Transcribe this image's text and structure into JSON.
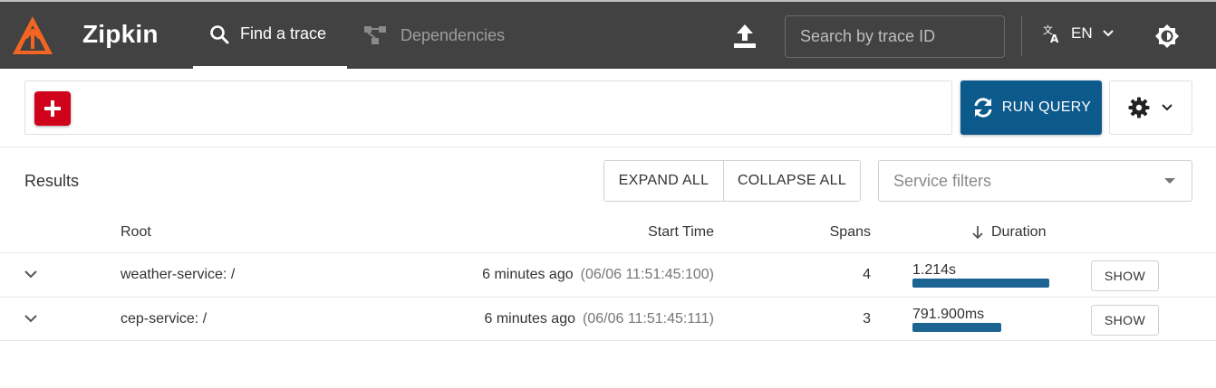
{
  "header": {
    "brand": "Zipkin",
    "tabs": [
      {
        "label": "Find a trace",
        "icon": "search-icon",
        "active": true
      },
      {
        "label": "Dependencies",
        "icon": "dependencies-icon",
        "active": false
      }
    ],
    "search_placeholder": "Search by trace ID",
    "language": "EN",
    "colors": {
      "bar": "#424242",
      "logo": "#f26522"
    }
  },
  "query": {
    "run_label": "RUN QUERY",
    "colors": {
      "add": "#d0021b",
      "run": "#0c5a8c"
    }
  },
  "results": {
    "title": "Results",
    "expand_label": "EXPAND ALL",
    "collapse_label": "COLLAPSE ALL",
    "service_filter_placeholder": "Service filters",
    "columns": {
      "root": "Root",
      "start_time": "Start Time",
      "spans": "Spans",
      "duration": "Duration"
    },
    "rows": [
      {
        "root": "weather-service: /",
        "relative_time": "6 minutes ago",
        "absolute_time": "(06/06 11:51:45:100)",
        "spans": "4",
        "duration": "1.214s",
        "duration_fraction": 1.0,
        "show_label": "SHOW"
      },
      {
        "root": "cep-service: /",
        "relative_time": "6 minutes ago",
        "absolute_time": "(06/06 11:51:45:111)",
        "spans": "3",
        "duration": "791.900ms",
        "duration_fraction": 0.652,
        "show_label": "SHOW"
      }
    ],
    "duration_bar_color": "#1c6593"
  }
}
